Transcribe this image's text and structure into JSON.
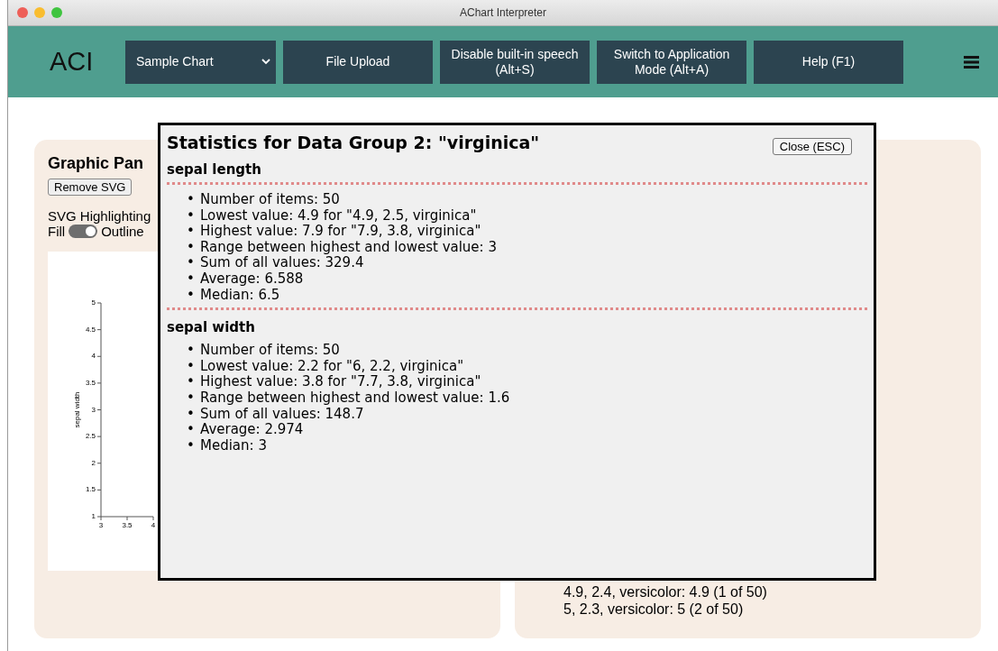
{
  "window": {
    "title": "AChart Interpreter"
  },
  "header": {
    "logo": "ACI",
    "select": "Sample Chart",
    "buttons": [
      "File Upload",
      "Disable built-in speech (Alt+S)",
      "Switch to Application Mode (Alt+A)",
      "Help (F1)"
    ]
  },
  "graphic_panel": {
    "title": "Graphic Pan",
    "button": "Remove SVG",
    "highlighting": {
      "label": "SVG Highlighting",
      "left_label": "Fill",
      "right_label": "Outline",
      "on": true
    },
    "chart_data": {
      "type": "scatter",
      "ylabel": "sepal width",
      "xlim": [
        3,
        4
      ],
      "ylim": [
        1,
        5
      ],
      "xticks": [
        3,
        3.5,
        4
      ],
      "yticks": [
        1,
        1.5,
        2,
        2.5,
        3,
        3.5,
        4,
        4.5,
        5
      ]
    }
  },
  "text_panel": {
    "lines": [
      "4.9, 2.4, versicolor: 4.9 (1 of 50)",
      "5, 2.3, versicolor: 5 (2 of 50)"
    ]
  },
  "dialog": {
    "title": "Statistics for Data Group 2: \"virginica\"",
    "close": "Close (ESC)",
    "bullet": "•",
    "sections": [
      {
        "heading": "sepal length",
        "divider": true,
        "items": [
          "Number of items: 50",
          "Lowest value: 4.9 for \"4.9, 2.5, virginica\"",
          "Highest value: 7.9 for \"7.9, 3.8, virginica\"",
          "Range between highest and lowest value: 3",
          "Sum of all values: 329.4",
          "Average: 6.588",
          "Median: 6.5"
        ]
      },
      {
        "heading": "sepal width",
        "divider": false,
        "items": [
          "Number of items: 50",
          "Lowest value: 2.2 for \"6, 2.2, virginica\"",
          "Highest value: 3.8 for \"7.7, 3.8, virginica\"",
          "Range between highest and lowest value: 1.6",
          "Sum of all values: 148.7",
          "Average: 2.974",
          "Median: 3"
        ]
      }
    ]
  }
}
